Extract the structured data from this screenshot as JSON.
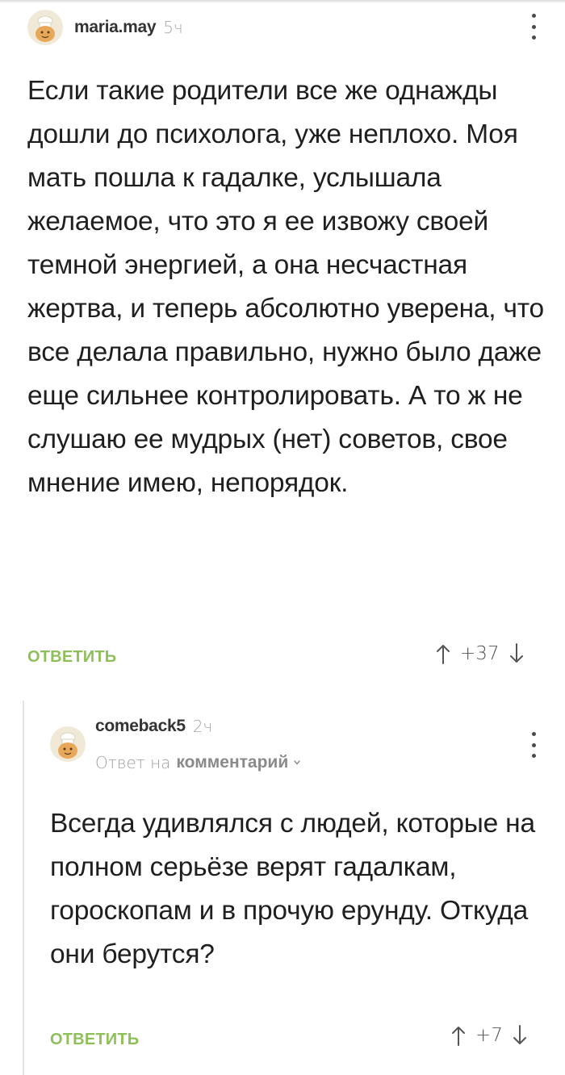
{
  "comments": [
    {
      "author": "maria.may",
      "time": "5ч",
      "text": "Если такие родители все же однажды дошли до психолога, уже неплохо. Моя мать пошла к гадалке, услышала желаемое, что это я ее извожу своей темной энергией, а она несчастная жертва, и теперь абсолютно уверена, что все делала правильно, нужно было даже еще сильнее контролировать. А то ж не слушаю ее мудрых (нет) советов, свое мнение имею, непорядок.",
      "reply_label": "ОТВЕТИТЬ",
      "rating": "+37"
    },
    {
      "author": "comeback5",
      "time": "2ч",
      "reply_prefix": "Ответ на",
      "reply_target": "комментарий",
      "text": "Всегда удивлялся с людей, которые на полном серьёзе верят гадалкам, гороскопам и в прочую ерунду. Откуда они берутся?",
      "reply_label": "ОТВЕТИТЬ",
      "rating": "+7"
    }
  ],
  "icons": {
    "avatar": "chef-avatar-icon",
    "more": "more-vertical-icon",
    "upvote": "arrow-up-icon",
    "downvote": "arrow-down-icon",
    "chevron": "chevron-down-icon"
  },
  "colors": {
    "reply_accent": "#8fbf5a",
    "text": "#1f1f1f",
    "muted": "#a8a8a8"
  }
}
